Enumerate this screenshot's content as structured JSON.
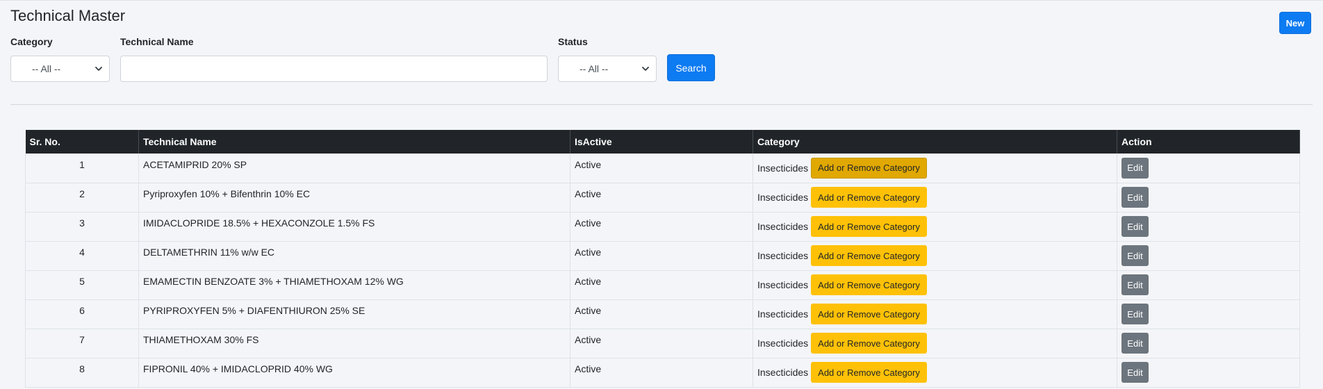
{
  "page": {
    "title": "Technical Master",
    "new_label": "New"
  },
  "filters": {
    "category_label": "Category",
    "category_value": "-- All --",
    "technical_name_label": "Technical Name",
    "technical_name_value": "",
    "status_label": "Status",
    "status_value": "-- All --",
    "search_label": "Search"
  },
  "table": {
    "headers": [
      "Sr. No.",
      "Technical Name",
      "IsActive",
      "Category",
      "Action"
    ],
    "add_remove_label": "Add or Remove Category",
    "edit_label": "Edit",
    "rows": [
      {
        "sr": "1",
        "name": "ACETAMIPRID 20% SP",
        "status": "Active",
        "category": "Insecticides"
      },
      {
        "sr": "2",
        "name": "Pyriproxyfen 10% + Bifenthrin 10% EC",
        "status": "Active",
        "category": "Insecticides"
      },
      {
        "sr": "3",
        "name": "IMIDACLOPRIDE 18.5% + HEXACONZOLE 1.5% FS",
        "status": "Active",
        "category": "Insecticides"
      },
      {
        "sr": "4",
        "name": "DELTAMETHRIN 11% w/w EC",
        "status": "Active",
        "category": "Insecticides"
      },
      {
        "sr": "5",
        "name": "EMAMECTIN BENZOATE 3% + THIAMETHOXAM 12% WG",
        "status": "Active",
        "category": "Insecticides"
      },
      {
        "sr": "6",
        "name": "PYRIPROXYFEN 5% + DIAFENTHIURON 25% SE",
        "status": "Active",
        "category": "Insecticides"
      },
      {
        "sr": "7",
        "name": "THIAMETHOXAM 30% FS",
        "status": "Active",
        "category": "Insecticides"
      },
      {
        "sr": "8",
        "name": "FIPRONIL 40% + IMIDACLOPRID 40% WG",
        "status": "Active",
        "category": "Insecticides"
      }
    ]
  }
}
